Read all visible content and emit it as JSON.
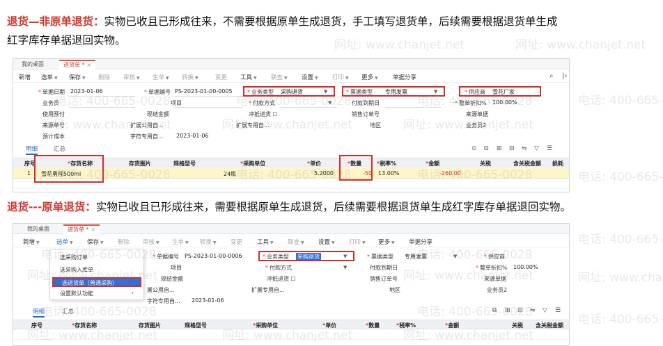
{
  "watermark": {
    "url_text": "网址: www.chanjet.net",
    "phone_text": "电话: 400-665-0028"
  },
  "section1": {
    "title": "退货—非原单退货：",
    "desc_line1": "实物已收且已形成往来，不需要根据原单生成退货，手工填写退货单，后续需要根据退货单生成",
    "desc_line2": "红字库存单据退回实物。"
  },
  "section2": {
    "title": "退货---原单退货：",
    "desc": "实物已收且已形成往来，需要根据原单生成退货，后续需要根据退货单生成红字库存单据退回实物。"
  },
  "screenshot1": {
    "tabs": [
      {
        "label": "我的桌面"
      },
      {
        "label": "进货单 *"
      }
    ],
    "close_glyph": "×",
    "toolbar": [
      "新增",
      "选单",
      "保存",
      "删除",
      "审核",
      "生单",
      "转换",
      "变更",
      "工具",
      "联查",
      "设置",
      "打印",
      "更多",
      "单据分享"
    ],
    "form": {
      "date_label": "单据日期",
      "date_value": "2023-01-06",
      "doc_no_label": "单据编号",
      "doc_no_value": "PS-2023-01-00-0005",
      "biz_type_label": "业务类型",
      "biz_type_value": "采购退货",
      "invoice_type_label": "票据类型",
      "invoice_type_value": "专用发票",
      "supplier_label": "供应商",
      "supplier_value": "雪花厂家",
      "clerk_label": "业务员",
      "project_label": "项目",
      "payment_label": "付款方式",
      "pay_date_label": "付款到期日",
      "discount_label": "整单折扣%",
      "discount_value": "100.00%",
      "prepay_label": "使用预付",
      "cash_amount_label": "现结金额",
      "offset_label": "冲抵进货",
      "sales_order_label": "销售订单号",
      "source_no_label": "来源单据",
      "source_no2_label": "来源单号",
      "ext_public_label": "扩展公用自...",
      "ext_special_label": "扩展专用自...",
      "region_label": "地区",
      "clerk2_label": "业务员2",
      "estimated_cost_label": "预计成本",
      "char_special_label": "字符专用自...",
      "char_special_value": "2023-01-06"
    },
    "subtabs": {
      "detail": "明细",
      "summary": "汇总"
    },
    "columns": [
      "序号",
      "存货名称",
      "存货图片",
      "规格型号",
      "采购单位",
      "单价",
      "数量",
      "税率%",
      "金额",
      "关税",
      "含关税金额",
      "损耗"
    ],
    "row": {
      "seq": "1",
      "item": "雪花勇闯500ml",
      "unit": "24瓶",
      "price": "5.2000",
      "qty": "-50",
      "tax": "13.00%",
      "amount": "-260.00"
    }
  },
  "screenshot2": {
    "tabs": [
      {
        "label": "我的桌面"
      },
      {
        "label": "进货单 *"
      }
    ],
    "close_glyph": "×",
    "toolbar": [
      "新增",
      "选单",
      "保存",
      "删除",
      "审核",
      "生单",
      "转换",
      "变更",
      "工具",
      "联查",
      "设置",
      "打印",
      "更多",
      "单据分享"
    ],
    "menu": [
      "选采购订单",
      "选采购入库单",
      "选进货单（普通采购）",
      "设置默认功能"
    ],
    "form": {
      "doc_no_label": "单据编号",
      "doc_no_value": "PS-2023-01-00-0006",
      "biz_type_label": "业务类型",
      "biz_type_value": "采购退货",
      "invoice_type_label": "票据类型",
      "invoice_type_value": "专用发票",
      "supplier_label": "供应商",
      "project_label": "项目",
      "payment_label": "付款方式",
      "pay_date_label": "付款到期日",
      "discount_label": "整单折扣%",
      "discount_value": "100.00%",
      "cash_amount_label": "现结金额",
      "offset_label": "冲抵进货",
      "source_no_label": "来源单据",
      "ext_public_label": "展公用自...",
      "sales_order_label": "销售订单号",
      "ext_special_label": "扩展专用自...",
      "region_label": "地区",
      "clerk2_label": "业务员2",
      "char_special_label": "字符专用自...",
      "char_special_value": "2023-01-06"
    },
    "subtabs": {
      "detail": "明细",
      "summary": "汇总"
    },
    "columns": [
      "序号",
      "存货名称",
      "存货图片",
      "规格型号",
      "采购单位",
      "单价",
      "数量",
      "税率%",
      "金额",
      "关税",
      "含关税金额"
    ]
  }
}
